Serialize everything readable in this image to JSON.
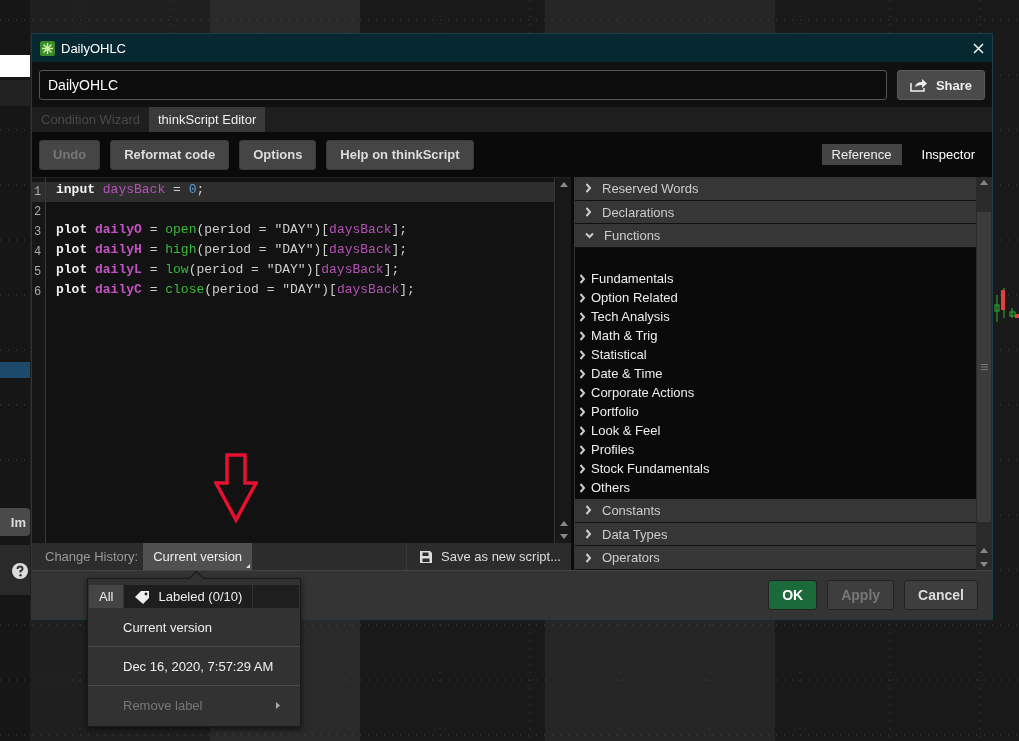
{
  "background": {
    "partial_button": "Im"
  },
  "window": {
    "title": "DailyOHLC"
  },
  "name_field": {
    "value": "DailyOHLC"
  },
  "share_button": {
    "label": "Share"
  },
  "tabs": [
    {
      "label": "Condition Wizard",
      "selected": false,
      "disabled": true
    },
    {
      "label": "thinkScript Editor",
      "selected": true,
      "disabled": false
    }
  ],
  "toolbar": [
    {
      "label": "Undo",
      "disabled": true
    },
    {
      "label": "Reformat code",
      "disabled": false
    },
    {
      "label": "Options",
      "disabled": false
    },
    {
      "label": "Help on thinkScript",
      "disabled": false
    }
  ],
  "view_toggle": [
    {
      "label": "Reference",
      "selected": true
    },
    {
      "label": "Inspector",
      "selected": false
    }
  ],
  "code": {
    "lines": [
      {
        "number": "1",
        "current": true,
        "tokens": [
          {
            "kind": "keyword",
            "text": "input"
          },
          {
            "kind": "ref",
            "text": "daysBack"
          },
          {
            "kind": "plain",
            "text": " = "
          },
          {
            "kind": "number",
            "text": "0"
          },
          {
            "kind": "plain",
            "text": ";"
          }
        ]
      },
      {
        "number": "2",
        "current": false
      },
      {
        "number": "3",
        "current": false,
        "tokens": [
          {
            "kind": "keyword",
            "text": "plot"
          },
          {
            "kind": "variable",
            "text": "dailyO"
          },
          {
            "kind": "plain",
            "text": " = "
          },
          {
            "kind": "function",
            "text": "open"
          },
          {
            "kind": "plain",
            "text": "(period = \"DAY\")["
          },
          {
            "kind": "ref",
            "text": "daysBack"
          },
          {
            "kind": "plain",
            "text": "];"
          }
        ]
      },
      {
        "number": "4",
        "current": false,
        "tokens": [
          {
            "kind": "keyword",
            "text": "plot"
          },
          {
            "kind": "variable",
            "text": "dailyH"
          },
          {
            "kind": "plain",
            "text": " = "
          },
          {
            "kind": "function",
            "text": "high"
          },
          {
            "kind": "plain",
            "text": "(period = \"DAY\")["
          },
          {
            "kind": "ref",
            "text": "daysBack"
          },
          {
            "kind": "plain",
            "text": "];"
          }
        ]
      },
      {
        "number": "5",
        "current": false,
        "tokens": [
          {
            "kind": "keyword",
            "text": "plot"
          },
          {
            "kind": "variable",
            "text": "dailyL"
          },
          {
            "kind": "plain",
            "text": " = "
          },
          {
            "kind": "function",
            "text": "low"
          },
          {
            "kind": "plain",
            "text": "(period = \"DAY\")["
          },
          {
            "kind": "ref",
            "text": "daysBack"
          },
          {
            "kind": "plain",
            "text": "];"
          }
        ]
      },
      {
        "number": "6",
        "current": false,
        "tokens": [
          {
            "kind": "keyword",
            "text": "plot"
          },
          {
            "kind": "variable",
            "text": "dailyC"
          },
          {
            "kind": "plain",
            "text": " = "
          },
          {
            "kind": "function",
            "text": "close"
          },
          {
            "kind": "plain",
            "text": "(period = \"DAY\")["
          },
          {
            "kind": "ref",
            "text": "daysBack"
          },
          {
            "kind": "plain",
            "text": "];"
          }
        ]
      }
    ]
  },
  "change_history": {
    "label": "Change History:",
    "value": "Current version"
  },
  "save_button": {
    "label": "Save as new script..."
  },
  "reference": {
    "sections": [
      {
        "label": "Reserved Words",
        "expanded": false
      },
      {
        "label": "Declarations",
        "expanded": false
      },
      {
        "label": "Functions",
        "expanded": true,
        "children": [
          {
            "label": "Fundamentals",
            "expanded": false
          },
          {
            "label": "Option Related",
            "expanded": false
          },
          {
            "label": "Tech Analysis",
            "expanded": false
          },
          {
            "label": "Math & Trig",
            "expanded": false
          },
          {
            "label": "Statistical",
            "expanded": false
          },
          {
            "label": "Date & Time",
            "expanded": false
          },
          {
            "label": "Corporate Actions",
            "expanded": false
          },
          {
            "label": "Portfolio",
            "expanded": false
          },
          {
            "label": "Look & Feel",
            "expanded": false
          },
          {
            "label": "Profiles",
            "expanded": false
          },
          {
            "label": "Stock Fundamentals",
            "expanded": false
          },
          {
            "label": "Others",
            "expanded": false
          }
        ]
      },
      {
        "label": "Constants",
        "expanded": false
      },
      {
        "label": "Data Types",
        "expanded": false
      },
      {
        "label": "Operators",
        "expanded": false
      }
    ]
  },
  "footer_buttons": [
    {
      "label": "OK",
      "kind": "primary",
      "disabled": false
    },
    {
      "label": "Apply",
      "kind": "normal",
      "disabled": true
    },
    {
      "label": "Cancel",
      "kind": "normal",
      "disabled": false
    }
  ],
  "history_menu": {
    "tabs": [
      {
        "label": "All",
        "selected": true
      },
      {
        "label": "Labeled (0/10)",
        "selected": false
      }
    ],
    "items": [
      {
        "label": "Current version",
        "disabled": false,
        "submenu": false
      },
      {
        "label": "Dec 16, 2020, 7:57:29 AM",
        "disabled": false,
        "submenu": false
      },
      {
        "label": "Remove label",
        "disabled": true,
        "submenu": true
      }
    ]
  }
}
